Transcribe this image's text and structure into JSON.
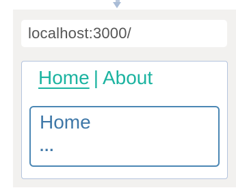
{
  "browser": {
    "url": "localhost:3000/"
  },
  "nav": {
    "home_label": "Home",
    "separator": "|",
    "about_label": "About"
  },
  "view": {
    "title": "Home",
    "body": "..."
  },
  "colors": {
    "link": "#1bb3a0",
    "view_border": "#4b87b4",
    "view_text": "#3f78a8",
    "frame_border": "#b3c3dd",
    "browser_bg": "#f2f1ef",
    "url_text": "#555555"
  }
}
